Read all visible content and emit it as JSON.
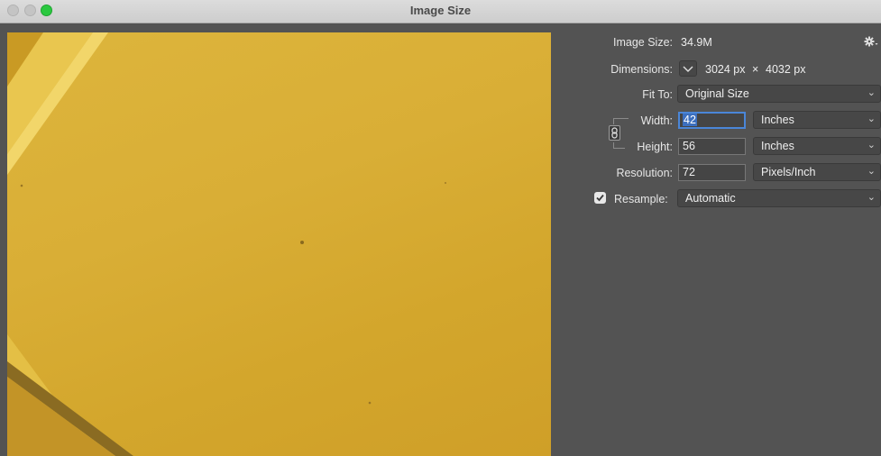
{
  "window": {
    "title": "Image Size"
  },
  "panel": {
    "image_size": {
      "label": "Image Size:",
      "value": "34.9M"
    },
    "dimensions": {
      "label": "Dimensions:",
      "width": "3024 px",
      "times": "×",
      "height": "4032 px"
    },
    "fit_to": {
      "label": "Fit To:",
      "value": "Original Size"
    },
    "width": {
      "label": "Width:",
      "value": "42",
      "unit": "Inches"
    },
    "height": {
      "label": "Height:",
      "value": "56",
      "unit": "Inches"
    },
    "resolution": {
      "label": "Resolution:",
      "value": "72",
      "unit": "Pixels/Inch"
    },
    "resample": {
      "label": "Resample:",
      "checked": true,
      "value": "Automatic"
    }
  },
  "icons": {
    "settings": "gear-icon",
    "link": "link-chain-icon",
    "dimensions_toggle": "chevron-down-icon",
    "dropdown": "chevron-down-icon",
    "check": "checkmark-icon"
  },
  "colors": {
    "accent": "#4a86d8",
    "panel_bg": "#535353",
    "preview_fill": "#d9ae36",
    "max_light": "#2bc840"
  }
}
